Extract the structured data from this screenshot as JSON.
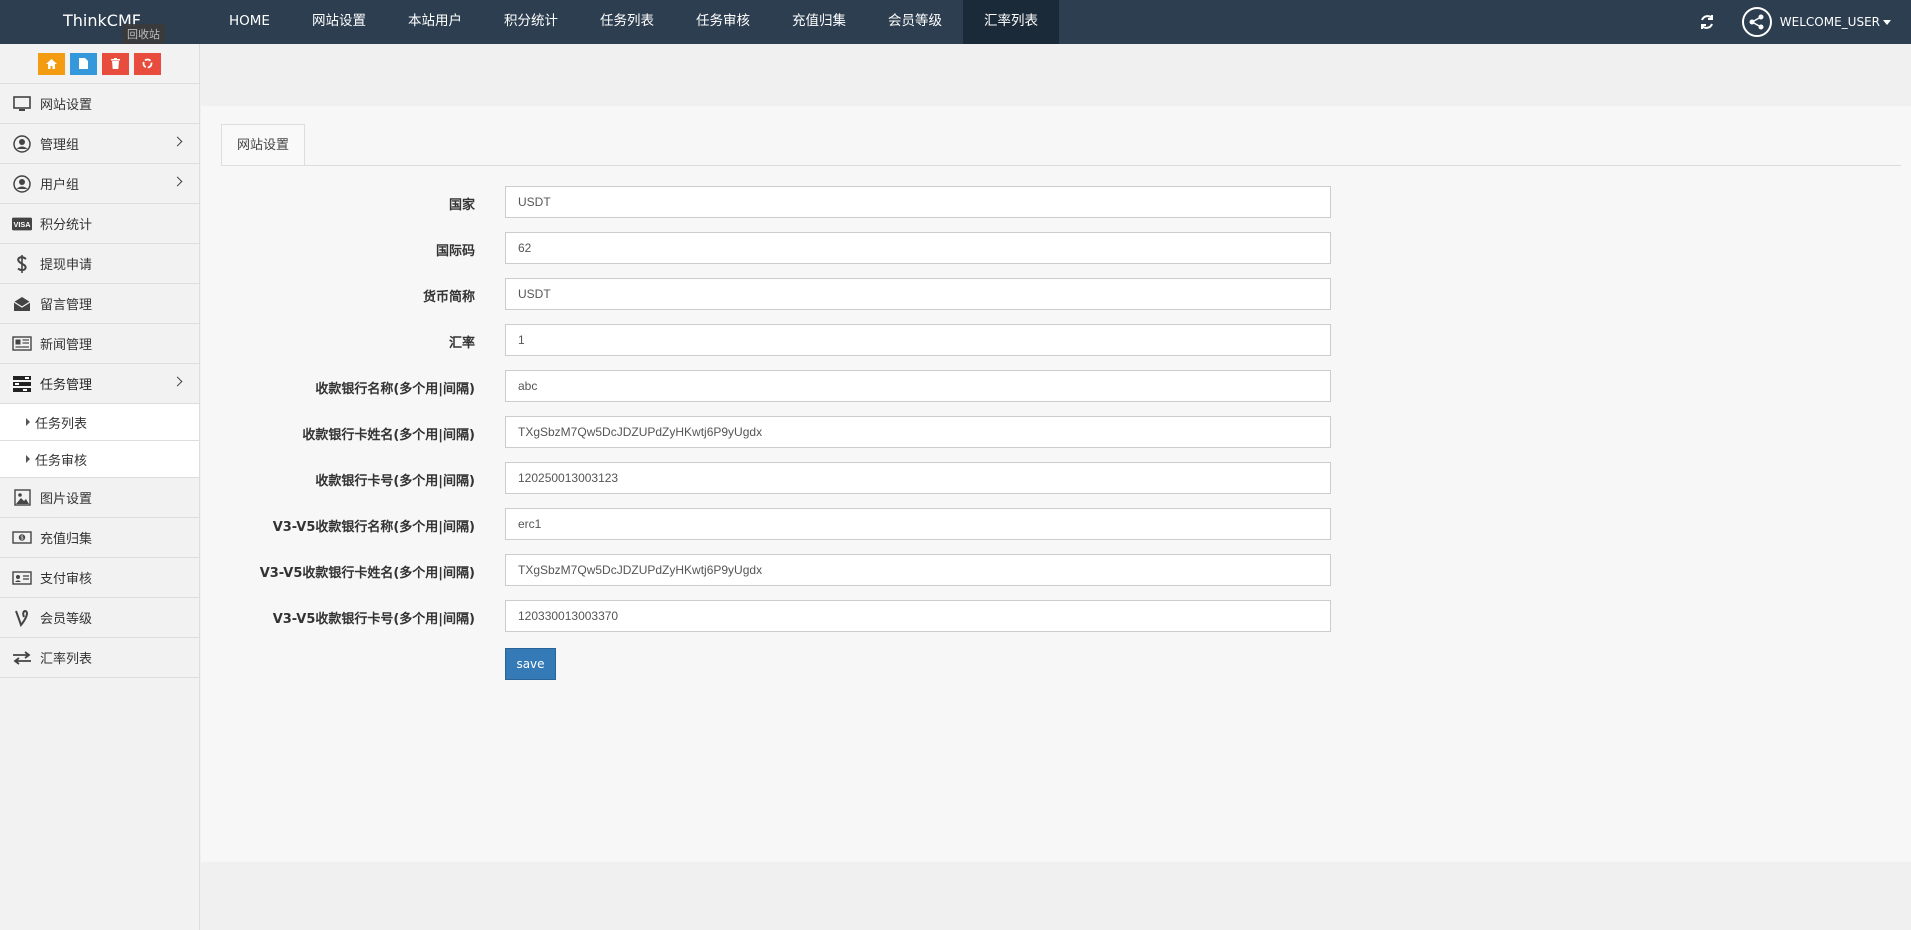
{
  "topbar": {
    "brand": "ThinkCMF",
    "nav": [
      {
        "label": "HOME"
      },
      {
        "label": "网站设置"
      },
      {
        "label": "本站用户"
      },
      {
        "label": "积分统计"
      },
      {
        "label": "任务列表"
      },
      {
        "label": "任务审核"
      },
      {
        "label": "充值归集"
      },
      {
        "label": "会员等级"
      },
      {
        "label": "汇率列表"
      }
    ],
    "active_nav": "汇率列表",
    "user": "WELCOME_USER"
  },
  "sidebar": {
    "tooltip": "回收站",
    "items": [
      {
        "label": "网站设置",
        "icon": "monitor-icon"
      },
      {
        "label": "管理组",
        "icon": "user-circle-icon",
        "has_children": true
      },
      {
        "label": "用户组",
        "icon": "user-circle-icon",
        "has_children": true
      },
      {
        "label": "积分统计",
        "icon": "visa-card-icon"
      },
      {
        "label": "提现申请",
        "icon": "dollar-icon"
      },
      {
        "label": "留言管理",
        "icon": "envelope-open-icon"
      },
      {
        "label": "新闻管理",
        "icon": "newspaper-icon"
      },
      {
        "label": "任务管理",
        "icon": "tasks-icon",
        "has_children": true,
        "open": true
      }
    ],
    "sub_items": [
      {
        "label": "任务列表"
      },
      {
        "label": "任务审核"
      }
    ],
    "items_after": [
      {
        "label": "图片设置",
        "icon": "image-icon"
      },
      {
        "label": "充值归集",
        "icon": "money-icon"
      },
      {
        "label": "支付审核",
        "icon": "id-card-icon"
      },
      {
        "label": "会员等级",
        "icon": "vine-icon"
      },
      {
        "label": "汇率列表",
        "icon": "exchange-icon"
      }
    ]
  },
  "main": {
    "tab": "网站设置",
    "fields": [
      {
        "label": "国家",
        "value": "USDT"
      },
      {
        "label": "国际码",
        "value": "62"
      },
      {
        "label": "货币简称",
        "value": "USDT"
      },
      {
        "label": "汇率",
        "value": "1"
      },
      {
        "label": "收款银行名称(多个用|间隔)",
        "value": "abc"
      },
      {
        "label": "收款银行卡姓名(多个用|间隔)",
        "value": "TXgSbzM7Qw5DcJDZUPdZyHKwtj6P9yUgdx"
      },
      {
        "label": "收款银行卡号(多个用|间隔)",
        "value": "120250013003123"
      },
      {
        "label": "V3-V5收款银行名称(多个用|间隔)",
        "value": "erc1"
      },
      {
        "label": "V3-V5收款银行卡姓名(多个用|间隔)",
        "value": "TXgSbzM7Qw5DcJDZUPdZyHKwtj6P9yUgdx"
      },
      {
        "label": "V3-V5收款银行卡号(多个用|间隔)",
        "value": "120330013003370"
      }
    ],
    "save_label": "save"
  },
  "colors": {
    "topbar": "#2c3e50",
    "primary": "#337ab7",
    "home_shortcut": "#f39c12",
    "file_shortcut": "#3498db",
    "danger_shortcut": "#e74c3c"
  }
}
